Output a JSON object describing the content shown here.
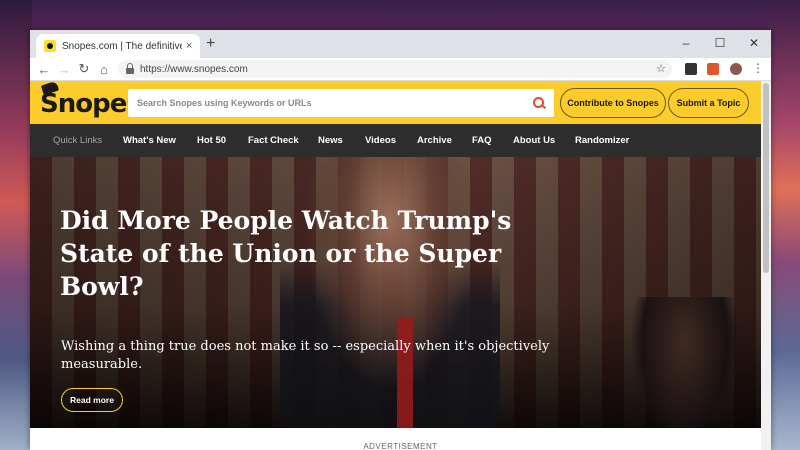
{
  "browser": {
    "tab_title": "Snopes.com | The definitive fact",
    "tab_close": "×",
    "new_tab": "+",
    "url": "https://www.snopes.com",
    "window_controls": {
      "minimize": "–",
      "maximize": "☐",
      "close": "✕"
    },
    "nav": {
      "back": "←",
      "forward": "→",
      "reload": "↻",
      "home": "⌂",
      "star": "☆"
    }
  },
  "site": {
    "logo": "Snopes",
    "search_placeholder": "Search Snopes using Keywords or URLs",
    "contribute_label": "Contribute to Snopes",
    "submit_label": "Submit a Topic",
    "accent_color": "#fbcc2c"
  },
  "nav": {
    "quick_links": "Quick Links",
    "items": [
      "What's New",
      "Hot 50",
      "Fact Check",
      "News",
      "Videos",
      "Archive",
      "FAQ",
      "About Us",
      "Randomizer"
    ]
  },
  "hero": {
    "headline": "Did More People Watch Trump's State of the Union or the Super Bowl?",
    "subtitle": "Wishing a thing true does not make it so -- especially when it's objectively measurable.",
    "read_more": "Read more"
  },
  "advertisement": "ADVERTISEMENT"
}
